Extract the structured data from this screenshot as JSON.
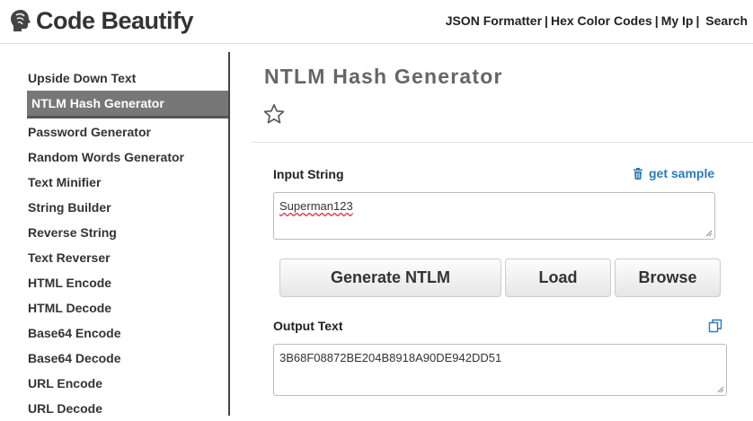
{
  "header": {
    "logo_text": "Code Beautify",
    "nav": [
      {
        "label": "JSON Formatter"
      },
      {
        "label": "Hex Color Codes"
      },
      {
        "label": "My Ip"
      },
      {
        "label": "Search"
      }
    ],
    "separator": "|"
  },
  "sidebar": {
    "items": [
      {
        "label": "Upside Down Text",
        "active": false
      },
      {
        "label": "NTLM Hash Generator",
        "active": true
      },
      {
        "label": "Password Generator",
        "active": false
      },
      {
        "label": "Random Words Generator",
        "active": false
      },
      {
        "label": "Text Minifier",
        "active": false
      },
      {
        "label": "String Builder",
        "active": false
      },
      {
        "label": "Reverse String",
        "active": false
      },
      {
        "label": "Text Reverser",
        "active": false
      },
      {
        "label": "HTML Encode",
        "active": false
      },
      {
        "label": "HTML Decode",
        "active": false
      },
      {
        "label": "Base64 Encode",
        "active": false
      },
      {
        "label": "Base64 Decode",
        "active": false
      },
      {
        "label": "URL Encode",
        "active": false
      },
      {
        "label": "URL Decode",
        "active": false
      }
    ]
  },
  "main": {
    "title": "NTLM Hash Generator",
    "input_label": "Input String",
    "get_sample_label": "get sample",
    "input_value": "Superman123",
    "buttons": {
      "generate": "Generate NTLM",
      "load": "Load",
      "browse": "Browse"
    },
    "output_label": "Output Text",
    "output_value": "3B68F08872BE204B8918A90DE942DD51"
  },
  "colors": {
    "accent_link": "#2a7ab8",
    "active_item_bg": "#777777"
  }
}
